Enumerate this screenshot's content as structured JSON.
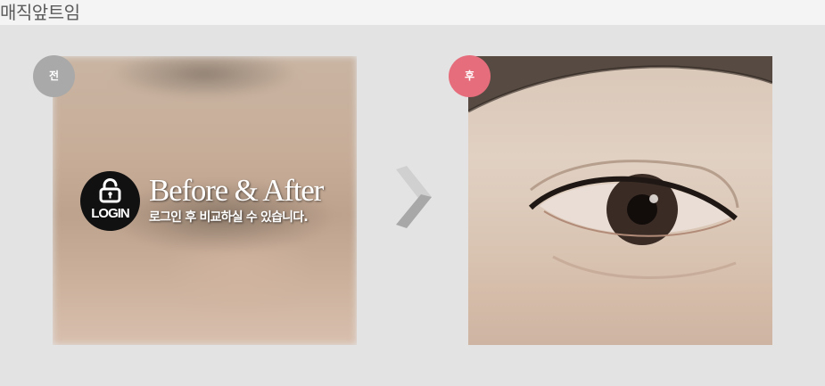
{
  "page": {
    "title": "매직앞트임"
  },
  "before": {
    "badge": "전",
    "login_button": "LOGIN",
    "heading": "Before & After",
    "notice": "로그인 후 비교하실 수 있습니다."
  },
  "after": {
    "badge": "후"
  },
  "colors": {
    "before_badge": "#a9a9a9",
    "after_badge": "#e66d7b",
    "background": "#e3e3e3"
  },
  "icons": {
    "lock": "lock-icon",
    "arrow": "chevron-right-icon"
  }
}
